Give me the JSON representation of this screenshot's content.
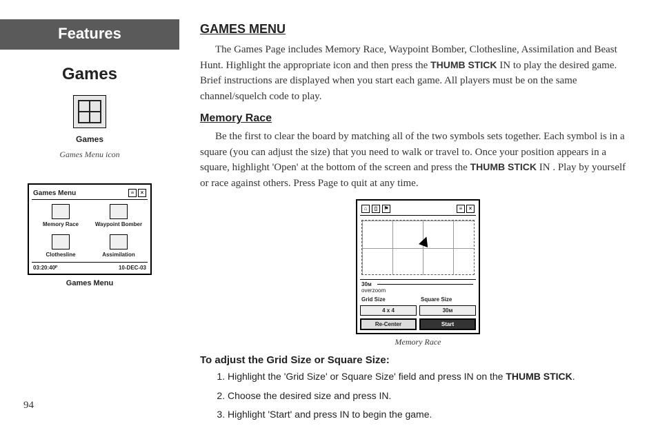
{
  "page_number": "94",
  "sidebar": {
    "features_label": "Features",
    "games_heading": "Games",
    "games_icon_label": "Games",
    "games_icon_caption": "Games Menu icon",
    "menu_shot": {
      "title": "Games Menu",
      "cells": [
        "Memory Race",
        "Waypoint Bomber",
        "Clothesline",
        "Assimilation"
      ],
      "status_left": "03:20:40ᴾ",
      "status_right": "10-DEC-03",
      "caption": "Games Menu"
    }
  },
  "main": {
    "section_heading": "GAMES MENU",
    "intro_pre": "The Games Page includes Memory Race, Waypoint Bomber, Clothesline, Assimilation and Beast Hunt.  Highlight the appropriate icon and then press the ",
    "thumb_stick": "THUMB STICK",
    "intro_post": " IN to play the desired game.  Brief instructions are displayed when you start each game.  All players must be on the same channel/squelch code to play.",
    "memory_heading": "Memory Race",
    "memory_pre": "Be the first to clear the board by matching all of the two symbols sets together.  Each symbol is in a square (you can adjust the size) that you need to walk or travel to.  Once your position appears in a square, highlight 'Open' at the bottom of the screen and press the ",
    "memory_post": " IN .  Play by yourself or race against others.  Press Page to quit at any time.",
    "race_shot": {
      "scale": "30",
      "scale_label": "30ᴍ",
      "overzoom": "overzoom",
      "grid_label": "Grid Size",
      "square_label": "Square Size",
      "grid_value": "4 x 4",
      "square_value": "30ᴍ",
      "recenter": "Re-Center",
      "start": "Start",
      "caption": "Memory Race"
    },
    "instr_heading": "To adjust the Grid Size or Square Size:",
    "steps": [
      {
        "pre": "Highlight the 'Grid Size' or Square Size' field and press IN on the ",
        "bold": "THUMB STICK",
        "post": "."
      },
      {
        "pre": "Choose the desired size and press IN.",
        "bold": "",
        "post": ""
      },
      {
        "pre": "Highlight 'Start' and press IN to begin the game.",
        "bold": "",
        "post": ""
      }
    ]
  }
}
